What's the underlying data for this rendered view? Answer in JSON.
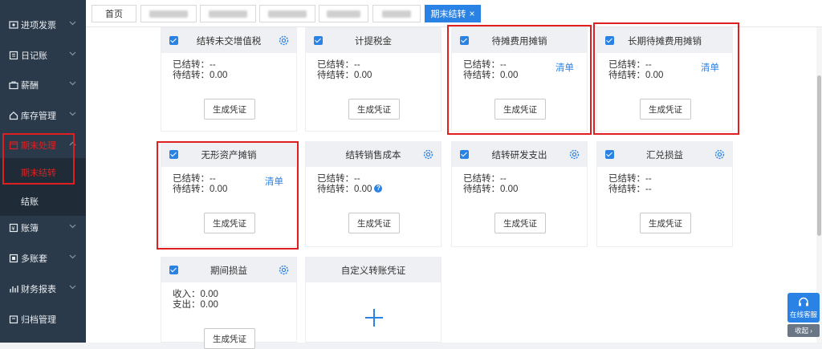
{
  "sidebar": {
    "items": [
      {
        "label": "进项发票",
        "icon": "invoice-icon"
      },
      {
        "label": "日记账",
        "icon": "ledger-icon"
      },
      {
        "label": "薪酬",
        "icon": "briefcase-icon"
      },
      {
        "label": "库存管理",
        "icon": "home-icon"
      },
      {
        "label": "期末处理",
        "icon": "calendar-icon"
      },
      {
        "label": "账簿",
        "icon": "book-icon"
      },
      {
        "label": "多账套",
        "icon": "stack-icon"
      },
      {
        "label": "财务报表",
        "icon": "report-icon"
      },
      {
        "label": "归档管理",
        "icon": "archive-icon"
      }
    ],
    "sub_items": [
      {
        "label": "期末结转"
      },
      {
        "label": "结账"
      }
    ]
  },
  "tabs": {
    "home": "首页",
    "active": "期末结转",
    "close": "×"
  },
  "colors": {
    "accent": "#2a82e4",
    "sidebar_bg": "#2b3a4a",
    "highlight_border": "#e02020"
  },
  "labels": {
    "carried": "已结转：",
    "pending": "待结转：",
    "income": "收入：",
    "expense": "支出：",
    "generate": "生成凭证",
    "list": "清单"
  },
  "cards": [
    {
      "title": "结转未交增值税",
      "carried": "--",
      "pending": "0.00"
    },
    {
      "title": "计提税金",
      "carried": "--",
      "pending": "0.00"
    },
    {
      "title": "待摊费用摊销",
      "carried": "--",
      "pending": "0.00"
    },
    {
      "title": "长期待摊费用摊销",
      "carried": "--",
      "pending": "0.00"
    },
    {
      "title": "无形资产摊销",
      "carried": "--",
      "pending": "0.00"
    },
    {
      "title": "结转销售成本",
      "carried": "--",
      "pending": "0.00"
    },
    {
      "title": "结转研发支出",
      "carried": "--",
      "pending": "0.00"
    },
    {
      "title": "汇兑损益",
      "carried": "--",
      "pending": "--"
    },
    {
      "title": "期间损益",
      "income": "0.00",
      "expense": "0.00"
    },
    {
      "title": "自定义转账凭证"
    }
  ],
  "float": {
    "service": "在线客服",
    "collapse": "收起"
  }
}
